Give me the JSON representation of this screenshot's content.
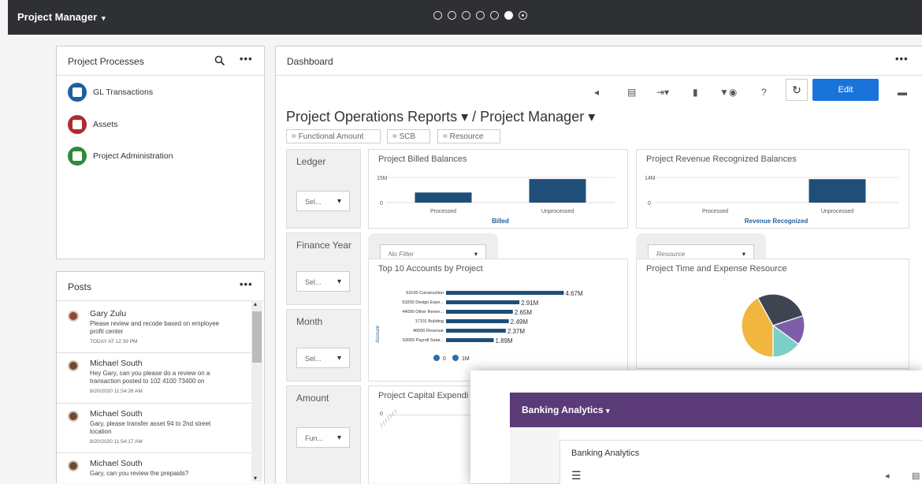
{
  "header": {
    "title": "Project Manager",
    "page_dots": 7,
    "active_dot": 6
  },
  "processes": {
    "title": "Project Processes",
    "items": [
      {
        "label": "GL Transactions",
        "color": "#1f5f9f"
      },
      {
        "label": "Assets",
        "color": "#b22a2a"
      },
      {
        "label": "Project Administration",
        "color": "#2e8b3a"
      }
    ]
  },
  "posts": {
    "title": "Posts",
    "items": [
      {
        "name": "Gary Zulu",
        "message": "Please review and recode based on employee profit center",
        "time": "TODAY AT 12:39 PM"
      },
      {
        "name": "Michael South",
        "message": "Hey Gary, can you please do a review on a transaction posted to 102 4100 73400 on",
        "time": "8/20/2020 11:54:26 AM"
      },
      {
        "name": "Michael South",
        "message": "Gary, please transfer asset 94 to 2nd street location",
        "time": "8/20/2020 11:54:17 AM"
      },
      {
        "name": "Michael South",
        "message": "Gary, can you review the prepaids?",
        "time": ""
      }
    ]
  },
  "dashboard": {
    "title": "Dashboard",
    "edit_label": "Edit",
    "report_title": "Project Operations Reports ▾  /  Project Manager ▾",
    "chips": [
      "= Functional Amount",
      "= SCB",
      "= Resource"
    ],
    "filters": [
      {
        "label": "Ledger",
        "value": "Sel..."
      },
      {
        "label": "Finance Year",
        "value": "Sel..."
      },
      {
        "label": "Month",
        "value": "Sel..."
      },
      {
        "label": "Amount",
        "value": "Fun..."
      }
    ],
    "dropdowns": {
      "no_filter": "No Filter",
      "resource": "Resource"
    },
    "cards": {
      "billed": "Project Billed Balances",
      "revenue": "Project Revenue Recognized Balances",
      "top10": "Top 10 Accounts by Project",
      "time": "Project Time and Expense Resource",
      "capital": "Project Capital Expendi"
    }
  },
  "chart_data": [
    {
      "type": "bar",
      "title": "Project Billed Balances",
      "categories": [
        "Processed",
        "Unprocessed"
      ],
      "values": [
        6,
        14
      ],
      "ylim": [
        0,
        15
      ],
      "ytick_labels": [
        "0",
        "15M"
      ],
      "xlabel": "Billed",
      "color": "#1f4e79"
    },
    {
      "type": "bar",
      "title": "Project Revenue Recognized Balances",
      "categories": [
        "Processed",
        "Unprocessed"
      ],
      "values": [
        0,
        13
      ],
      "ylim": [
        0,
        14
      ],
      "ytick_labels": [
        "0",
        "14M"
      ],
      "xlabel": "Revenue Recognized",
      "color": "#1f4e79"
    },
    {
      "type": "bar",
      "orientation": "horizontal",
      "title": "Top 10 Accounts by Project",
      "ylabel": "Account",
      "categories": [
        "53100 Construction",
        "53200 Design Expe...",
        "44000 Other Reven...",
        "17101 Building",
        "40000 Revenue",
        "53000 Payroll Salar..."
      ],
      "values": [
        4.67,
        2.91,
        2.65,
        2.49,
        2.37,
        1.89
      ],
      "data_labels": [
        "4.67M",
        "2.91M",
        "2.65M",
        "2.49M",
        "2.37M",
        "1.89M"
      ],
      "legend": [
        "0",
        "1M"
      ],
      "color": "#1f4e79"
    },
    {
      "type": "pie",
      "title": "Project Time and Expense Resource",
      "values": [
        42,
        28,
        15,
        15
      ],
      "colors": [
        "#f0b63f",
        "#3f4550",
        "#7e5ea8",
        "#7ccfc8"
      ]
    }
  ],
  "overlay": {
    "title": "Banking Analytics",
    "inner_title": "Banking Analytics"
  }
}
